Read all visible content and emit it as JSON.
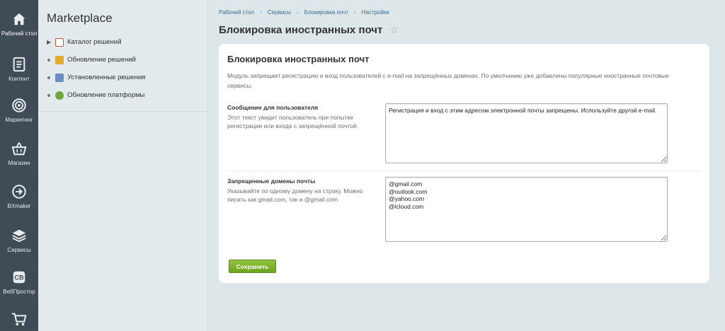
{
  "colors": {
    "rail_bg": "#3f4b55",
    "accent_green": "#7ab32a",
    "link": "#3d6d91"
  },
  "rail": [
    {
      "label": "Рабочий стол",
      "icon": "home-icon"
    },
    {
      "label": "Контент",
      "icon": "document-icon"
    },
    {
      "label": "Маркетинг",
      "icon": "target-icon"
    },
    {
      "label": "Магазин",
      "icon": "basket-icon"
    },
    {
      "label": "BXmaker",
      "icon": "arrow-circle-icon"
    },
    {
      "label": "Сервисы",
      "icon": "layers-icon"
    },
    {
      "label": "ВебПростор",
      "icon": "webprostor-icon"
    },
    {
      "label": "",
      "icon": "cart-icon"
    }
  ],
  "menu": {
    "title": "Marketplace",
    "items": [
      {
        "label": "Каталог решений",
        "icon": "catalog-icon"
      },
      {
        "label": "Обновление решений",
        "icon": "update-icon"
      },
      {
        "label": "Установленные решения",
        "icon": "installed-icon"
      },
      {
        "label": "Обновление платформы",
        "icon": "platform-update-icon"
      }
    ]
  },
  "breadcrumb": [
    "Рабочий стол",
    "Сервисы",
    "Блокировка почт",
    "Настройки"
  ],
  "page_title": "Блокировка иностранных почт",
  "card": {
    "title": "Блокировка иностранных почт",
    "description": "Модуль запрещает регистрацию и вход пользователей с e-mail на запрещённых доменах. По умолчанию уже добавлены популярные иностранные почтовые сервисы.",
    "message_field": {
      "label": "Сообщение для пользователя",
      "hint": "Этот текст увидит пользователь при попытке регистрации или входа с запрещённой почтой.",
      "value": "Регистрация и вход с этим адресом электронной почты запрещены. Используйте другой e-mail."
    },
    "domains_field": {
      "label": "Запрещенные домены почты",
      "hint": "Указывайте по одному домену на строку. Можно писать как gmail.com, так и @gmail.com.",
      "value": "@gmail.com\n@outlook.com\n@yahoo.com\n@icloud.com"
    },
    "save_label": "Сохранить"
  }
}
